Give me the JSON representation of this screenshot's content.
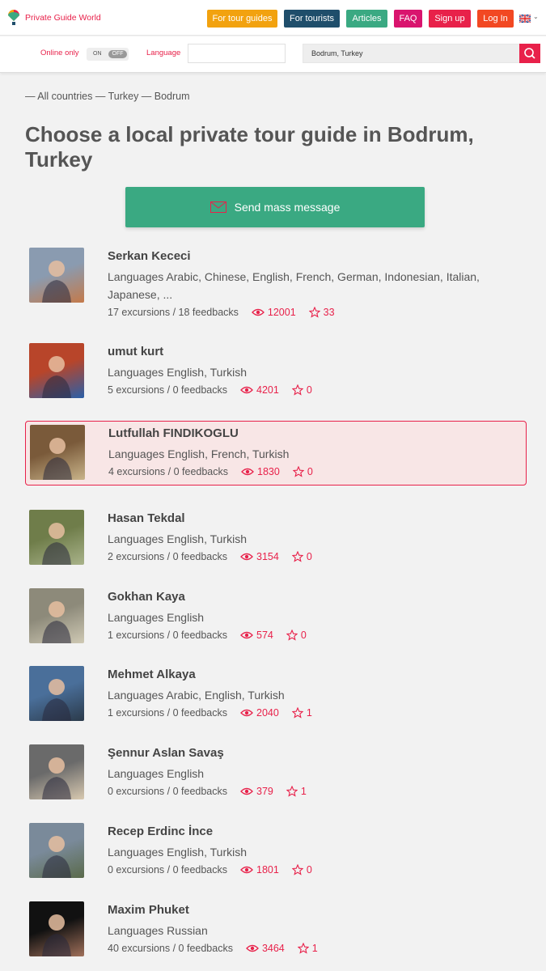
{
  "header": {
    "logo_text": "Private Guide World",
    "nav": [
      {
        "label": "For tour guides",
        "color": "#f2a20f"
      },
      {
        "label": "For tourists",
        "color": "#1f4e6b"
      },
      {
        "label": "Articles",
        "color": "#3aa982"
      },
      {
        "label": "FAQ",
        "color": "#d9146e"
      },
      {
        "label": "Sign up",
        "color": "#e8214a"
      },
      {
        "label": "Log In",
        "color": "#f24822"
      }
    ],
    "language_flag": "uk-flag-icon"
  },
  "filters": {
    "online_label": "Online only",
    "toggle_on": "ON",
    "toggle_off": "OFF",
    "language_label": "Language",
    "language_value": "",
    "location_value": "Bodrum, Turkey"
  },
  "breadcrumb": "— All countries — Turkey — Bodrum",
  "title": "Choose a local private tour guide in Bodrum, Turkey",
  "mass_message_label": "Send mass message",
  "colors": {
    "accent": "#e8214a",
    "green": "#3aa982"
  },
  "guides": [
    {
      "name": "Serkan Kececi",
      "languages": "Languages Arabic, Chinese, English, French, German, Indonesian, Italian, Japanese, ...",
      "stats": "17 excursions / 18 feedbacks",
      "views": "12001",
      "stars": "33"
    },
    {
      "name": "umut kurt",
      "languages": "Languages English, Turkish",
      "stats": "5 excursions / 0 feedbacks",
      "views": "4201",
      "stars": "0"
    },
    {
      "name": "Lutfullah FINDIKOGLU",
      "languages": "Languages English, French, Turkish",
      "stats": "4 excursions / 0 feedbacks",
      "views": "1830",
      "stars": "0"
    },
    {
      "name": "Hasan Tekdal",
      "languages": "Languages English, Turkish",
      "stats": "2 excursions / 0 feedbacks",
      "views": "3154",
      "stars": "0"
    },
    {
      "name": "Gokhan Kaya",
      "languages": "Languages English",
      "stats": "1 excursions / 0 feedbacks",
      "views": "574",
      "stars": "0"
    },
    {
      "name": "Mehmet Alkaya",
      "languages": "Languages Arabic, English, Turkish",
      "stats": "1 excursions / 0 feedbacks",
      "views": "2040",
      "stars": "1"
    },
    {
      "name": "Şennur Aslan Savaş",
      "languages": "Languages English",
      "stats": "0 excursions / 0 feedbacks",
      "views": "379",
      "stars": "1"
    },
    {
      "name": "Recep Erdinc İnce",
      "languages": "Languages English, Turkish",
      "stats": "0 excursions / 0 feedbacks",
      "views": "1801",
      "stars": "0"
    },
    {
      "name": "Maxim Phuket",
      "languages": "Languages Russian",
      "stats": "40 excursions / 0 feedbacks",
      "views": "3464",
      "stars": "1"
    }
  ]
}
